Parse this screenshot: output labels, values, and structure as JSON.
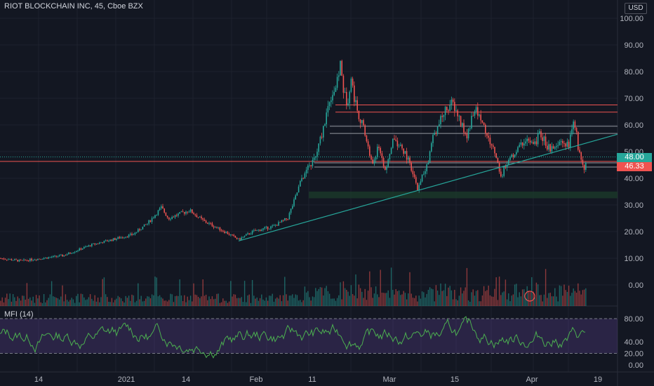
{
  "header": {
    "title": "RIOT BLOCKCHAIN INC, 45, Cboe BZX",
    "currency": "USD"
  },
  "chart_data": {
    "type": "candlestick",
    "title": "RIOT BLOCKCHAIN INC, 45, Cboe BZX",
    "price_axis": {
      "labels": [
        "100.00",
        "90.00",
        "80.00",
        "70.00",
        "60.00",
        "50.00",
        "40.00",
        "30.00",
        "20.00",
        "10.00",
        "0.00"
      ],
      "ylim": [
        0,
        100
      ]
    },
    "x_labels": [
      "14",
      "2021",
      "14",
      "Feb",
      "11",
      "Mar",
      "15",
      "Apr",
      "19"
    ],
    "price_path": [
      [
        0,
        10
      ],
      [
        30,
        9
      ],
      [
        60,
        10
      ],
      [
        90,
        11
      ],
      [
        110,
        13
      ],
      [
        130,
        15
      ],
      [
        160,
        17
      ],
      [
        190,
        19
      ],
      [
        210,
        23
      ],
      [
        230,
        29
      ],
      [
        240,
        25
      ],
      [
        270,
        28
      ],
      [
        290,
        24
      ],
      [
        320,
        20
      ],
      [
        340,
        17
      ],
      [
        360,
        20
      ],
      [
        390,
        22
      ],
      [
        410,
        25
      ],
      [
        420,
        32
      ],
      [
        430,
        40
      ],
      [
        440,
        44
      ],
      [
        450,
        48
      ],
      [
        460,
        58
      ],
      [
        470,
        70
      ],
      [
        480,
        75
      ],
      [
        485,
        83
      ],
      [
        490,
        72
      ],
      [
        495,
        68
      ],
      [
        500,
        78
      ],
      [
        505,
        70
      ],
      [
        510,
        65
      ],
      [
        520,
        57
      ],
      [
        530,
        45
      ],
      [
        540,
        52
      ],
      [
        550,
        42
      ],
      [
        560,
        55
      ],
      [
        570,
        52
      ],
      [
        580,
        48
      ],
      [
        595,
        36
      ],
      [
        600,
        40
      ],
      [
        610,
        45
      ],
      [
        615,
        55
      ],
      [
        625,
        60
      ],
      [
        635,
        66
      ],
      [
        645,
        68
      ],
      [
        655,
        62
      ],
      [
        665,
        55
      ],
      [
        675,
        66
      ],
      [
        685,
        63
      ],
      [
        695,
        55
      ],
      [
        705,
        50
      ],
      [
        715,
        40
      ],
      [
        720,
        45
      ],
      [
        735,
        50
      ],
      [
        750,
        55
      ],
      [
        760,
        52
      ],
      [
        770,
        57
      ],
      [
        780,
        52
      ],
      [
        790,
        50
      ],
      [
        800,
        54
      ],
      [
        810,
        52
      ],
      [
        818,
        62
      ],
      [
        825,
        50
      ],
      [
        832,
        44
      ],
      [
        836,
        46
      ]
    ],
    "levels": [
      {
        "type": "horizontal",
        "value": 67.5,
        "color": "#ef5350"
      },
      {
        "type": "horizontal",
        "value": 64.8,
        "color": "#ef5350"
      },
      {
        "type": "horizontal",
        "value": 59.5,
        "color": "#9598a1"
      },
      {
        "type": "horizontal",
        "value": 56.8,
        "color": "#9598a1"
      },
      {
        "type": "horizontal",
        "value": 45.8,
        "color": "#9598a1"
      },
      {
        "type": "horizontal",
        "value": 44.2,
        "color": "#9598a1"
      }
    ],
    "trendline": {
      "from": [
        340,
        16.5
      ],
      "to": [
        880,
        56.5
      ],
      "color": "#26a69a"
    },
    "current_price": {
      "value": "48.00",
      "color": "#26a69a"
    },
    "red_level": {
      "value": "46.33",
      "color": "#ef5350"
    },
    "volume": {
      "labels": [
        "0.00"
      ]
    },
    "mfi": {
      "title": "MFI (14)",
      "labels": [
        "80.00",
        "40.00",
        "20.00",
        "0.00"
      ],
      "upper": 80,
      "lower": 20,
      "ylim": [
        0,
        100
      ]
    },
    "colors": {
      "up": "#26a69a",
      "down": "#ef5350",
      "mfi_line": "#4caf50",
      "mfi_band": "#7e57c2"
    }
  }
}
